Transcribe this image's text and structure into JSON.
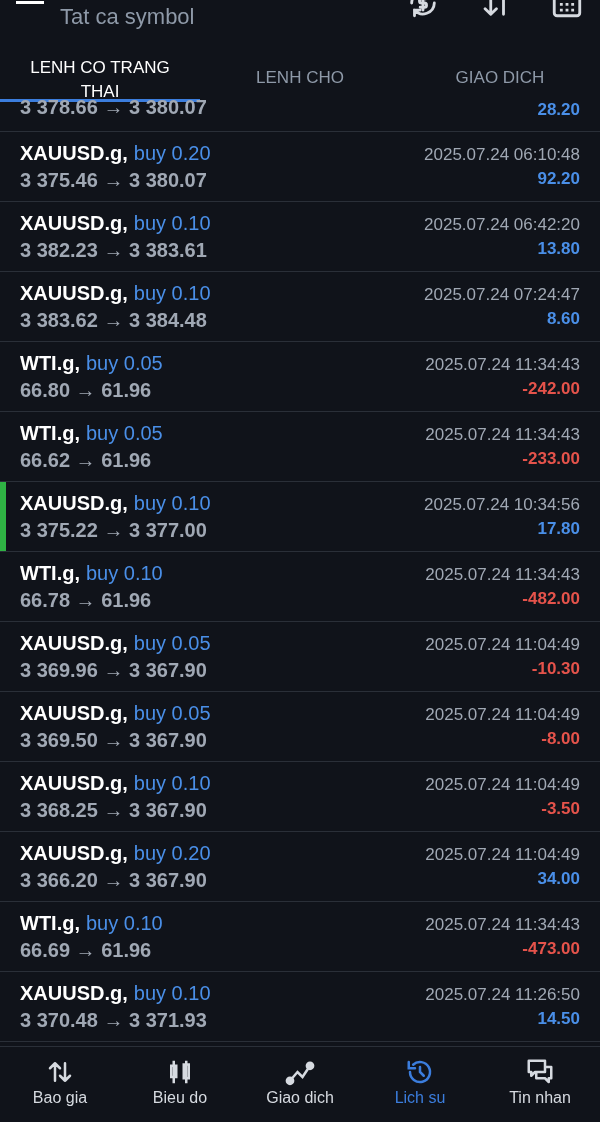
{
  "header": {
    "filter": "Tat ca symbol"
  },
  "tabs": [
    {
      "label": "LENH CO TRANG THAI",
      "selected": true
    },
    {
      "label": "LENH CHO",
      "selected": false
    },
    {
      "label": "GIAO DICH",
      "selected": false
    }
  ],
  "partial_row": {
    "prices": "3 378.66 → 3 380.07",
    "profit": "28.20",
    "color": "#4a8fe8"
  },
  "deals": [
    {
      "symbol": "XAUUSD.g,",
      "side": "buy 0.20",
      "prices": "3 375.46 → 3 380.07",
      "time": "2025.07.24 06:10:48",
      "profit": "92.20",
      "color": "#4a8fe8",
      "marked": false
    },
    {
      "symbol": "XAUUSD.g,",
      "side": "buy 0.10",
      "prices": "3 382.23 → 3 383.61",
      "time": "2025.07.24 06:42:20",
      "profit": "13.80",
      "color": "#4a8fe8",
      "marked": false
    },
    {
      "symbol": "XAUUSD.g,",
      "side": "buy 0.10",
      "prices": "3 383.62 → 3 384.48",
      "time": "2025.07.24 07:24:47",
      "profit": "8.60",
      "color": "#4a8fe8",
      "marked": false
    },
    {
      "symbol": "WTI.g,",
      "side": "buy 0.05",
      "prices": "66.80 → 61.96",
      "time": "2025.07.24 11:34:43",
      "profit": "-242.00",
      "color": "#e5534b",
      "marked": false
    },
    {
      "symbol": "WTI.g,",
      "side": "buy 0.05",
      "prices": "66.62 → 61.96",
      "time": "2025.07.24 11:34:43",
      "profit": "-233.00",
      "color": "#e5534b",
      "marked": false
    },
    {
      "symbol": "XAUUSD.g,",
      "side": "buy 0.10",
      "prices": "3 375.22 → 3 377.00",
      "time": "2025.07.24 10:34:56",
      "profit": "17.80",
      "color": "#4a8fe8",
      "marked": true
    },
    {
      "symbol": "WTI.g,",
      "side": "buy 0.10",
      "prices": "66.78 → 61.96",
      "time": "2025.07.24 11:34:43",
      "profit": "-482.00",
      "color": "#e5534b",
      "marked": false
    },
    {
      "symbol": "XAUUSD.g,",
      "side": "buy 0.05",
      "prices": "3 369.96 → 3 367.90",
      "time": "2025.07.24 11:04:49",
      "profit": "-10.30",
      "color": "#e5534b",
      "marked": false
    },
    {
      "symbol": "XAUUSD.g,",
      "side": "buy 0.05",
      "prices": "3 369.50 → 3 367.90",
      "time": "2025.07.24 11:04:49",
      "profit": "-8.00",
      "color": "#e5534b",
      "marked": false
    },
    {
      "symbol": "XAUUSD.g,",
      "side": "buy 0.10",
      "prices": "3 368.25 → 3 367.90",
      "time": "2025.07.24 11:04:49",
      "profit": "-3.50",
      "color": "#e5534b",
      "marked": false
    },
    {
      "symbol": "XAUUSD.g,",
      "side": "buy 0.20",
      "prices": "3 366.20 → 3 367.90",
      "time": "2025.07.24 11:04:49",
      "profit": "34.00",
      "color": "#4a8fe8",
      "marked": false
    },
    {
      "symbol": "WTI.g,",
      "side": "buy 0.10",
      "prices": "66.69 → 61.96",
      "time": "2025.07.24 11:34:43",
      "profit": "-473.00",
      "color": "#e5534b",
      "marked": false
    },
    {
      "symbol": "XAUUSD.g,",
      "side": "buy 0.10",
      "prices": "3 370.48 → 3 371.93",
      "time": "2025.07.24 11:26:50",
      "profit": "14.50",
      "color": "#4a8fe8",
      "marked": false
    }
  ],
  "nav": [
    {
      "kind": "quotes",
      "label": "Bao gia",
      "selected": false
    },
    {
      "kind": "chart",
      "label": "Bieu do",
      "selected": false
    },
    {
      "kind": "trade",
      "label": "Giao dich",
      "selected": false
    },
    {
      "kind": "history",
      "label": "Lich su",
      "selected": true
    },
    {
      "kind": "messages",
      "label": "Tin nhan",
      "selected": false
    }
  ]
}
